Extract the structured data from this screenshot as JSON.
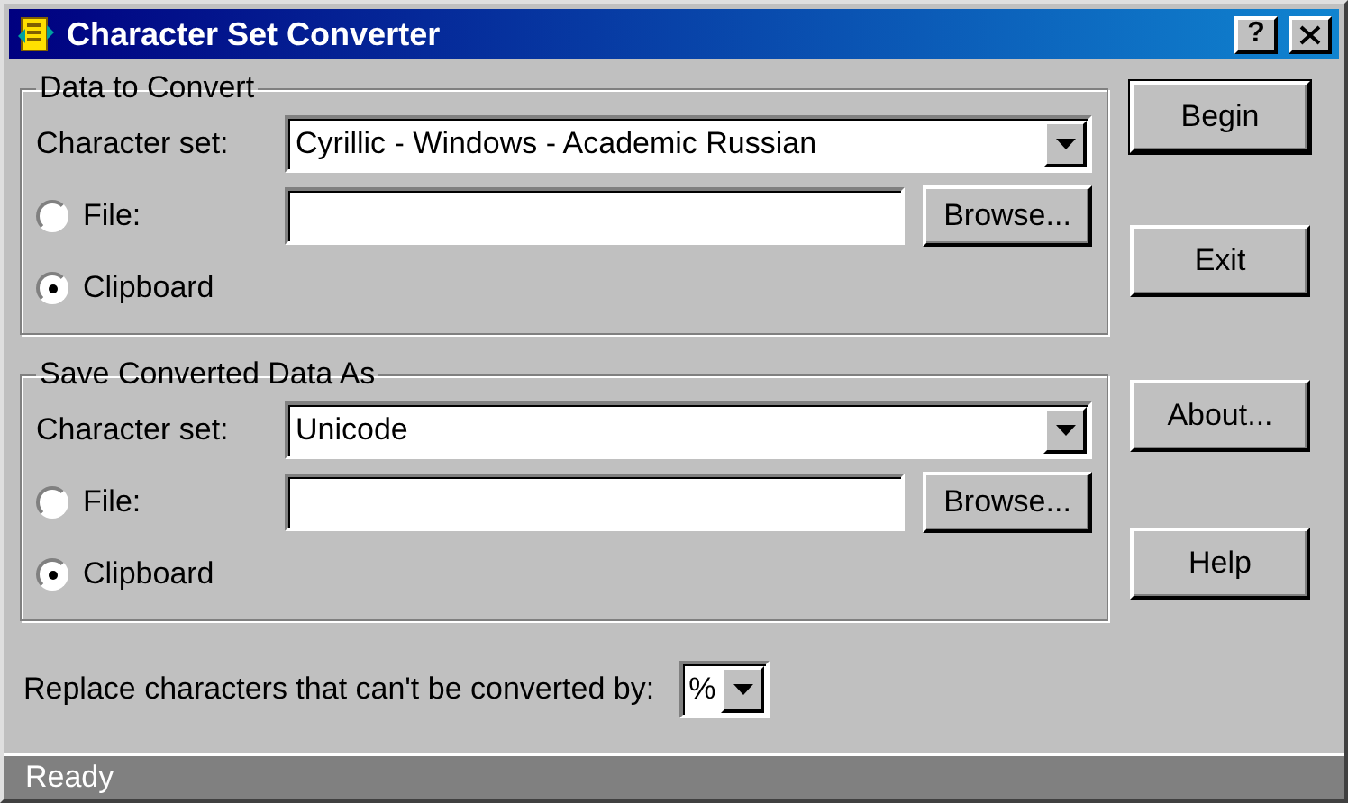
{
  "window": {
    "title": "Character Set Converter",
    "help_button": "?"
  },
  "groups": [
    {
      "title": "Data to Convert",
      "charset_label": "Character set:",
      "charset_value": "Cyrillic - Windows - Academic Russian",
      "browse": "Browse...",
      "options": [
        {
          "label": "File:",
          "selected": false
        },
        {
          "label": "Clipboard",
          "selected": true
        }
      ]
    },
    {
      "title": "Save Converted Data As",
      "charset_label": "Character set:",
      "charset_value": "Unicode",
      "browse": "Browse...",
      "options": [
        {
          "label": "File:",
          "selected": false
        },
        {
          "label": "Clipboard",
          "selected": true
        }
      ]
    }
  ],
  "buttons": [
    {
      "label": "Begin",
      "default": true
    },
    {
      "label": "Exit",
      "default": false
    },
    {
      "label": "About...",
      "default": false
    },
    {
      "label": "Help",
      "default": false
    }
  ],
  "replace": {
    "label": "Replace characters that can't be converted by:",
    "value": "%"
  },
  "status_bar": "Ready"
}
